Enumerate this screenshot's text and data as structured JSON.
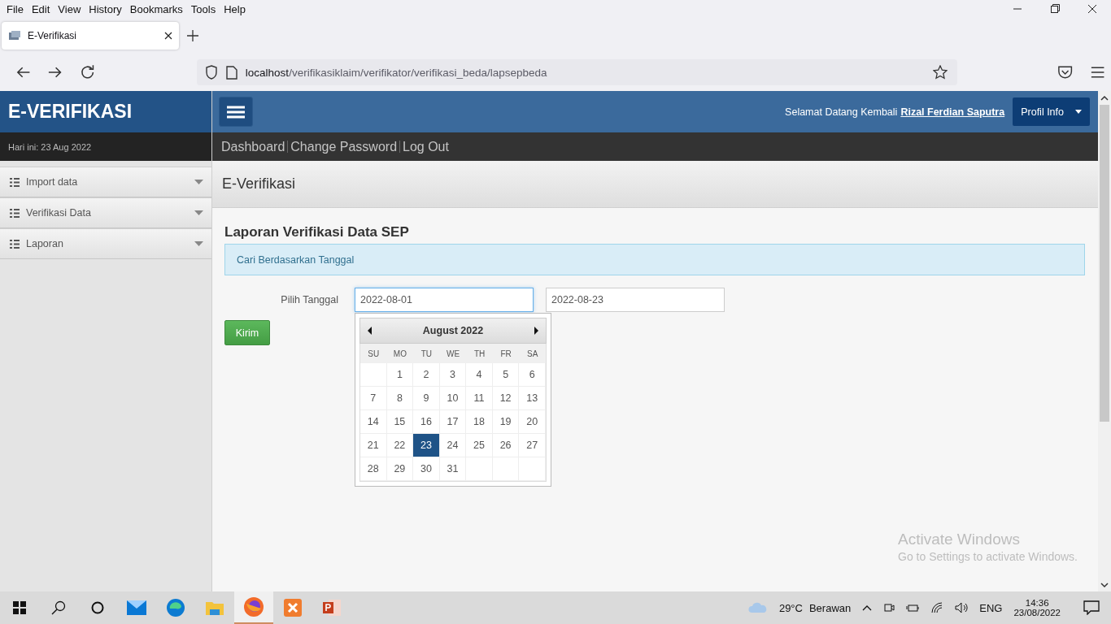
{
  "menu_bar": [
    "File",
    "Edit",
    "View",
    "History",
    "Bookmarks",
    "Tools",
    "Help"
  ],
  "tabs": [
    {
      "label": "E-Verifikasi",
      "selected": true
    }
  ],
  "address_bar": {
    "host": "localhost",
    "path": "/verifikasiklaim/verifikator/verifikasi_beda/lapsepbeda"
  },
  "app": {
    "brand": "E-VERIFIKASI",
    "date_text": "Hari ini: 23 Aug 2022",
    "welcome": "Selamat Datang Kembali",
    "user": "Rizal Ferdian Saputra",
    "profile_button": "Profil Info",
    "top_links": [
      "Dashboard",
      "Change Password",
      "Log Out"
    ],
    "sidebar": [
      {
        "label": "Import data",
        "expanded": false
      },
      {
        "label": "Verifikasi Data",
        "expanded": false
      },
      {
        "label": "Laporan",
        "expanded": false
      }
    ],
    "page_title": "E-Verifikasi",
    "section_title": "Laporan Verifikasi Data SEP",
    "info_box": "Cari Berdasarkan Tanggal",
    "date_label": "Pilih Tanggal",
    "date_from": {
      "value": "2022-08-01",
      "focused": true
    },
    "date_to": {
      "value": "2022-08-23",
      "focused": false
    },
    "submit_button": "Kirim",
    "calendar": {
      "month": "August 2022",
      "weekdays": [
        "SU",
        "MO",
        "TU",
        "WE",
        "TH",
        "FR",
        "SA"
      ],
      "weeks": [
        [
          {
            "label": "1",
            "selected": false
          },
          {
            "label": "2",
            "selected": false
          },
          {
            "label": "3",
            "selected": false
          },
          {
            "label": "4",
            "selected": false
          },
          {
            "label": "5",
            "selected": false
          },
          {
            "label": "6",
            "selected": false
          }
        ],
        [
          {
            "label": "7",
            "selected": false
          },
          {
            "label": "8",
            "selected": false
          },
          {
            "label": "9",
            "selected": false
          },
          {
            "label": "10",
            "selected": false
          },
          {
            "label": "11",
            "selected": false
          },
          {
            "label": "12",
            "selected": false
          },
          {
            "label": "13",
            "selected": false
          }
        ],
        [
          {
            "label": "14",
            "selected": false
          },
          {
            "label": "15",
            "selected": false
          },
          {
            "label": "16",
            "selected": false
          },
          {
            "label": "17",
            "selected": false
          },
          {
            "label": "18",
            "selected": false
          },
          {
            "label": "19",
            "selected": false
          },
          {
            "label": "20",
            "selected": false
          }
        ],
        [
          {
            "label": "21",
            "selected": false
          },
          {
            "label": "22",
            "selected": false
          },
          {
            "label": "23",
            "selected": true
          },
          {
            "label": "24",
            "selected": false
          },
          {
            "label": "25",
            "selected": false
          },
          {
            "label": "26",
            "selected": false
          },
          {
            "label": "27",
            "selected": false
          }
        ],
        [
          {
            "label": "28",
            "selected": false
          },
          {
            "label": "29",
            "selected": false
          },
          {
            "label": "30",
            "selected": false
          },
          {
            "label": "31",
            "selected": false
          }
        ]
      ]
    }
  },
  "activation_notice": {
    "title": "Activate Windows",
    "text": "Go to Settings to activate Windows."
  },
  "taskbar": {
    "apps": [
      {
        "kind": "mail",
        "selected": false
      },
      {
        "kind": "edge",
        "selected": false
      },
      {
        "kind": "folder",
        "selected": false
      },
      {
        "kind": "firefox",
        "selected": true
      },
      {
        "kind": "xampp",
        "selected": false
      },
      {
        "kind": "powerpoint",
        "selected": false
      }
    ],
    "weather": "29°C",
    "weather_text": "Berawan",
    "language": "ENG",
    "time": "14:36",
    "date": "23/08/2022"
  }
}
